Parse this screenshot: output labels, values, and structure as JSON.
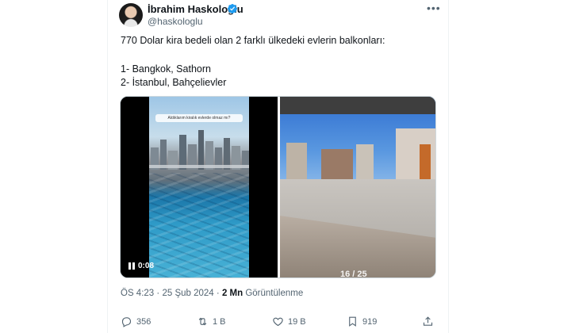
{
  "author": {
    "name": "İbrahim Haskoloğlu",
    "handle": "@haskologlu"
  },
  "tweet": {
    "lines": [
      "770 Dolar kira bedeli olan 2 farklı ülkedeki evlerin balkonları:",
      "1- Bangkok, Sathorn",
      "2- İstanbul, Bahçelievler"
    ]
  },
  "media": {
    "video_time": "0:08",
    "video_caption": "Aldıklarım kiralık evlerde olmaz mı?",
    "counter": "16 / 25"
  },
  "meta": {
    "time": "ÖS 4:23",
    "date": "25 Şub 2024",
    "separator": "·",
    "views_count": "2 Mn",
    "views_label": "Görüntülenme"
  },
  "actions": {
    "reply": "356",
    "retweet": "1 B",
    "like": "19 B",
    "bookmark": "919"
  },
  "colors": {
    "verified": "#1d9bf0",
    "text": "#0f1419",
    "secondary": "#536471"
  }
}
